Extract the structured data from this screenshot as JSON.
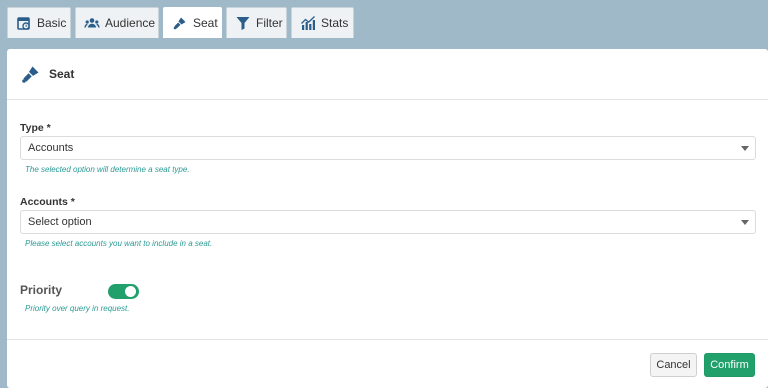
{
  "tabs": [
    {
      "label": "Basic",
      "icon": "calendar-icon",
      "active": false
    },
    {
      "label": "Audience",
      "icon": "audience-icon",
      "active": false
    },
    {
      "label": "Seat",
      "icon": "seat-icon",
      "active": true
    },
    {
      "label": "Filter",
      "icon": "funnel-icon",
      "active": false
    },
    {
      "label": "Stats",
      "icon": "stats-chart-icon",
      "active": false
    }
  ],
  "panel": {
    "title": "Seat",
    "icon": "seat-icon"
  },
  "form": {
    "type": {
      "label": "Type *",
      "value": "Accounts",
      "help": "The selected option will determine a seat type."
    },
    "accounts": {
      "label": "Accounts *",
      "placeholder": "Select option",
      "help": "Please select accounts you want to include in a seat."
    },
    "priority": {
      "label": "Priority",
      "enabled": true,
      "help": "Priority over query in request."
    }
  },
  "footer": {
    "cancel_label": "Cancel",
    "confirm_label": "Confirm"
  },
  "colors": {
    "accent": "#22a06b",
    "help_text": "#2a9a95",
    "page_bg": "#9fb9c9"
  }
}
